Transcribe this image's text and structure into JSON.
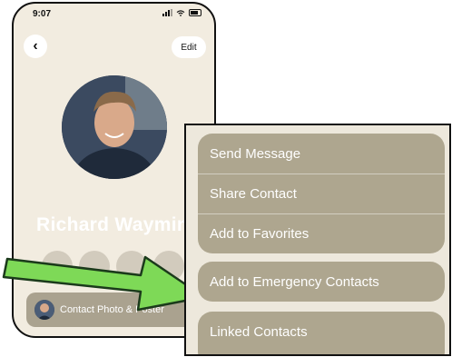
{
  "status": {
    "time": "9:07"
  },
  "nav": {
    "back_glyph": "‹",
    "edit_label": "Edit"
  },
  "contact": {
    "name": "Richard Waymin"
  },
  "photo_poster": {
    "label": "Contact Photo & Poster"
  },
  "menu": {
    "group1": [
      "Send Message",
      "Share Contact",
      "Add to Favorites"
    ],
    "group2": [
      "Add to Emergency Contacts"
    ],
    "group3": [
      "Linked Contacts"
    ]
  },
  "colors": {
    "phone_bg": "#f2ece0",
    "menu_item_bg": "#aea68f",
    "arrow_fill": "#7ed957"
  }
}
